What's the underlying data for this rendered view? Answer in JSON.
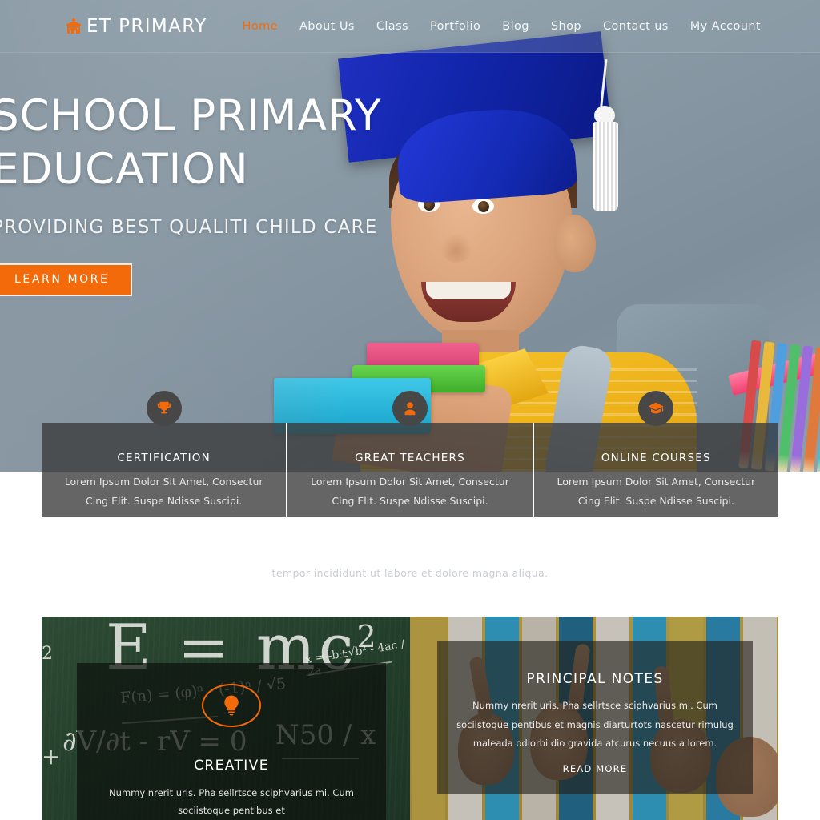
{
  "header": {
    "logo_icon": "school-building-icon",
    "logo_text": "ET PRIMARY",
    "nav": [
      {
        "label": "Home",
        "active": true
      },
      {
        "label": "About Us",
        "active": false
      },
      {
        "label": "Class",
        "active": false
      },
      {
        "label": "Portfolio",
        "active": false
      },
      {
        "label": "Blog",
        "active": false
      },
      {
        "label": "Shop",
        "active": false
      },
      {
        "label": "Contact us",
        "active": false
      },
      {
        "label": "My Account",
        "active": false
      }
    ],
    "accent_color": "#f36c0a"
  },
  "hero": {
    "title_line1": "SCHOOL PRIMARY",
    "title_line2": "EDUCATION",
    "subtitle": "PROVIDING BEST QUALITI CHILD CARE",
    "cta_label": "LEARN MORE",
    "cta_color": "#f36a0a"
  },
  "features": [
    {
      "icon": "trophy-icon",
      "title": "CERTIFICATION",
      "body": "Lorem Ipsum Dolor Sit Amet, Consectur Cing Elit. Suspe Ndisse Suscipi."
    },
    {
      "icon": "user-icon",
      "title": "GREAT TEACHERS",
      "body": "Lorem Ipsum Dolor Sit Amet, Consectur Cing Elit. Suspe Ndisse Suscipi."
    },
    {
      "icon": "graduation-cap-icon",
      "title": "ONLINE COURSES",
      "body": "Lorem Ipsum Dolor Sit Amet, Consectur Cing Elit. Suspe Ndisse Suscipi."
    }
  ],
  "tagline": "tempor incididunt ut labore et dolore magna aliqua.",
  "creative": {
    "icon": "lightbulb-icon",
    "title": "CREATIVE",
    "body": "Nummy nrerit uris. Pha sellrtsce sciphvarius mi. Cum sociistoque pentibus et",
    "chalkboard": {
      "formula_main": "E = mc",
      "formula_main_sup": "2",
      "formula_two": "2",
      "formula_quadratic": "x = -b±√b² - 4ac / 2a",
      "formula_fibonacci": "F(n) = (φ)ⁿ - (-1)ⁿ / √5",
      "formula_dv": "∂V/∂t - rV = 0",
      "formula_n50": "N50 / x",
      "formula_plus": "+"
    }
  },
  "principal": {
    "title": "PRINCIPAL NOTES",
    "body_line1": "Nummy nrerit uris. Pha sellrtsce sciphvarius mi. Cum sociistoque pentibus et",
    "body_line2": "magnis diarturtots nascetur rimulug maleada odiorbi dio gravida atcurus necuus",
    "body_line3": "a lorem.",
    "read_more_label": "READ MORE"
  }
}
